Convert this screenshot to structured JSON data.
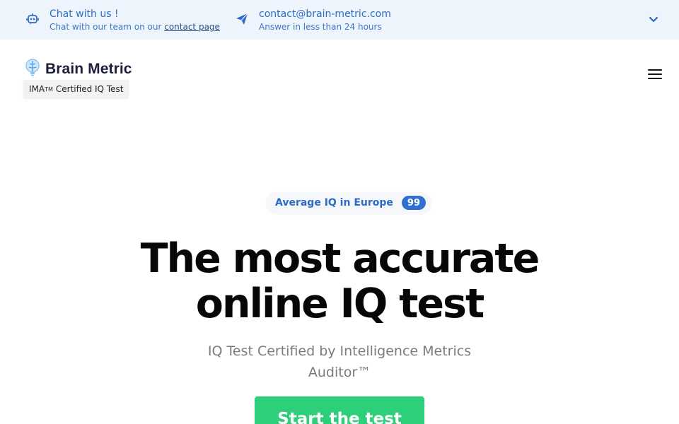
{
  "topbar": {
    "chat": {
      "icon": "robot-icon",
      "title": "Chat with us !",
      "subtitle_prefix": "Chat with our team on our ",
      "subtitle_link": "contact page"
    },
    "mail": {
      "icon": "paper-plane-icon",
      "title": "contact@brain-metric.com",
      "subtitle": "Answer in less than 24 hours"
    },
    "toggle_icon": "chevron-down-icon"
  },
  "header": {
    "logo_icon": "brain-bulb-icon",
    "brand": "Brain Metric",
    "badge_prefix": "IMA",
    "badge_tm": "TM",
    "badge_suffix": "Certified IQ Test",
    "menu_icon": "hamburger-menu-icon"
  },
  "hero": {
    "pill_label": "Average IQ in Europe",
    "pill_value": "99",
    "title_line1": "The most accurate",
    "title_line2": "online IQ test",
    "subtitle": "IQ Test Certified by Intelligence Metrics Auditor™",
    "cta_label": "Start the test"
  },
  "colors": {
    "topbar_bg": "#edf4fc",
    "accent_blue": "#2d6cc4",
    "badge_blue": "#2f6fd0",
    "cta_green": "#2ecf7a",
    "title_dark": "#070707",
    "subtitle_gray": "#7b7b7b"
  }
}
